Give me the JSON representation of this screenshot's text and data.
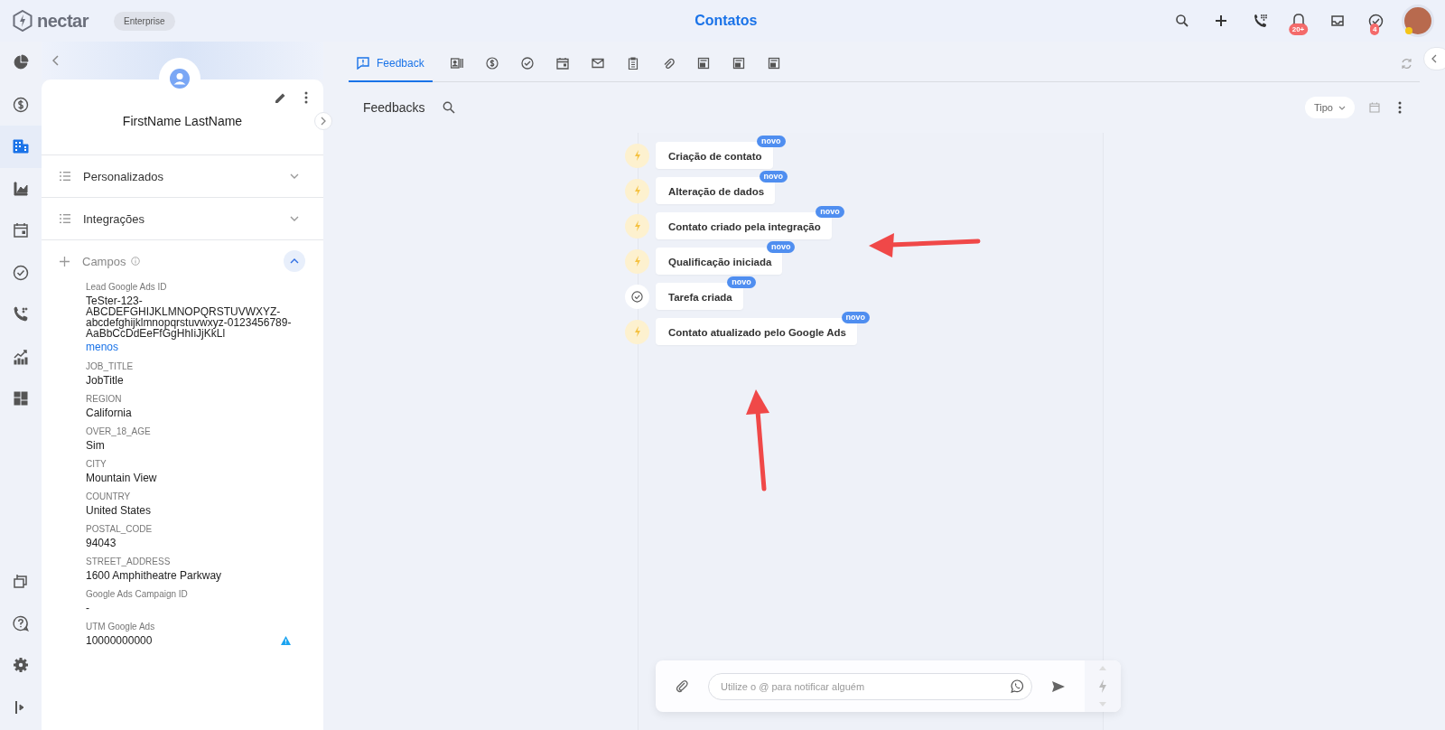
{
  "topbar": {
    "logo": "nectar",
    "plan": "Enterprise",
    "title": "Contatos",
    "notifications_badge": "20+",
    "tasks_badge": "4"
  },
  "rail": {
    "top": [
      {
        "selected": false
      },
      {
        "selected": false
      },
      {
        "selected": true
      },
      {
        "selected": false
      },
      {
        "selected": false
      },
      {
        "selected": false
      },
      {
        "selected": false
      },
      {
        "selected": false
      },
      {
        "selected": false
      }
    ],
    "bottom": [
      {
        "selected": false
      },
      {
        "selected": false
      },
      {
        "selected": false
      },
      {
        "selected": false
      }
    ]
  },
  "contact": {
    "name": "FirstName LastName",
    "sections": [
      {
        "label": "Personalizados",
        "expanded": false
      },
      {
        "label": "Integrações",
        "expanded": false
      },
      {
        "label": "Campos",
        "expanded": true
      }
    ],
    "fields": [
      {
        "label": "Lead Google Ads ID",
        "value": "TeSter-123-ABCDEFGHIJKLMNOPQRSTUVWXYZ-abcdefghijklmnopqrstuvwxyz-0123456789-AaBbCcDdEeFfGgHhIiJjKkLl",
        "link": "menos"
      },
      {
        "label": "JOB_TITLE",
        "value": "JobTitle"
      },
      {
        "label": "REGION",
        "value": "California"
      },
      {
        "label": "OVER_18_AGE",
        "value": "Sim"
      },
      {
        "label": "CITY",
        "value": "Mountain View"
      },
      {
        "label": "COUNTRY",
        "value": "United States"
      },
      {
        "label": "POSTAL_CODE",
        "value": "94043"
      },
      {
        "label": "STREET_ADDRESS",
        "value": "1600 Amphitheatre Parkway"
      },
      {
        "label": "Google Ads Campaign ID",
        "value": "-"
      },
      {
        "label": "UTM Google Ads",
        "value": "10000000000",
        "warning": true
      }
    ]
  },
  "tabs": [
    {
      "label": "Feedback",
      "selected": true
    },
    {
      "selected": false
    },
    {
      "selected": false
    },
    {
      "selected": false
    },
    {
      "selected": false
    },
    {
      "selected": false
    },
    {
      "selected": false
    },
    {
      "selected": false
    },
    {
      "selected": false
    },
    {
      "selected": false
    },
    {
      "selected": false
    }
  ],
  "feedbacks": {
    "title": "Feedbacks",
    "filter": "Tipo",
    "events": [
      {
        "kind": "automation",
        "label": "Criação de contato",
        "badge": "novo"
      },
      {
        "kind": "automation",
        "label": "Alteração de dados",
        "badge": "novo"
      },
      {
        "kind": "automation",
        "label": "Contato criado pela integração",
        "badge": "novo"
      },
      {
        "kind": "automation",
        "label": "Qualificação iniciada",
        "badge": "novo"
      },
      {
        "kind": "task",
        "label": "Tarefa criada",
        "badge": "novo"
      },
      {
        "kind": "automation",
        "label": "Contato atualizado pelo Google Ads",
        "badge": "novo"
      }
    ]
  },
  "composer": {
    "placeholder": "Utilize o @ para notificar alguém"
  }
}
